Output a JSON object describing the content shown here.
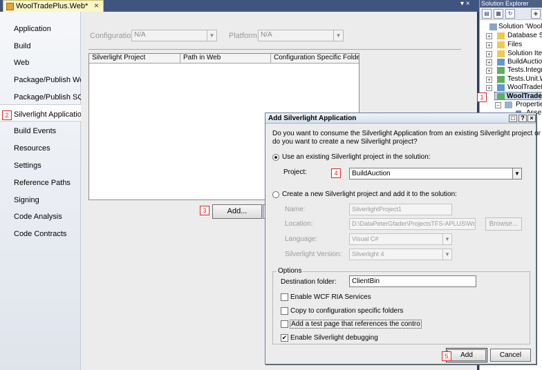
{
  "window": {
    "tab_title": "WoolTradePlus.Web*",
    "tab_close": "×",
    "tab_arrows": "▾ ×"
  },
  "nav": {
    "items": [
      {
        "label": "Application"
      },
      {
        "label": "Build"
      },
      {
        "label": "Web"
      },
      {
        "label": "Package/Publish Web"
      },
      {
        "label": "Package/Publish SQL"
      },
      {
        "label": "Silverlight Applications"
      },
      {
        "label": "Build Events"
      },
      {
        "label": "Resources"
      },
      {
        "label": "Settings"
      },
      {
        "label": "Reference Paths"
      },
      {
        "label": "Signing"
      },
      {
        "label": "Code Analysis"
      },
      {
        "label": "Code Contracts"
      }
    ],
    "selected_index": 5
  },
  "page": {
    "configuration_label": "Configuration:",
    "configuration_value": "N/A",
    "platform_label": "Platform:",
    "platform_value": "N/A",
    "table": {
      "columns": [
        "Silverlight Project",
        "Path in Web",
        "Configuration Specific Folders"
      ]
    },
    "add_button": "Add..."
  },
  "callouts": [
    "1",
    "2",
    "3",
    "4",
    "5"
  ],
  "solution_explorer": {
    "title": "Solution Explorer",
    "toolbar_icons": [
      "properties-icon",
      "show-all-files-icon",
      "refresh-icon",
      "view-class-diagram-icon"
    ],
    "items": [
      {
        "label": "Solution 'WoolTra",
        "expander": "−"
      },
      {
        "label": "Database Sc",
        "expander": "+"
      },
      {
        "label": "Files",
        "expander": "+"
      },
      {
        "label": "Solution Item",
        "expander": "+"
      },
      {
        "label": "BuildAuction",
        "expander": "+"
      },
      {
        "label": "Tests.Integr",
        "expander": "+"
      },
      {
        "label": "Tests.Unit.W",
        "expander": "+"
      },
      {
        "label": "WoolTradePl",
        "expander": "+"
      },
      {
        "label": "WoolTrade",
        "expander": "−"
      },
      {
        "label": "Propertie",
        "expander": "−"
      },
      {
        "label": "Asse",
        "expander": ""
      }
    ]
  },
  "dialog": {
    "title": "Add Silverlight Application",
    "title_buttons": [
      "□",
      "?",
      "×"
    ],
    "intro_line1": "Do you want to consume the Silverlight Application from an existing Silverlight project or",
    "intro_line2": "do you want to create a new Silverlight project?",
    "use_existing_label": "Use an existing Silverlight project in the solution:",
    "use_existing_selected": true,
    "project_label": "Project:",
    "project_value": "BuildAuction",
    "create_new_label": "Create a new Silverlight project and add it to the solution:",
    "name_label": "Name:",
    "name_value": "SilverlightProject1",
    "location_label": "Location:",
    "location_value": "D:\\DataPeterGfader\\ProjectsTFS-APLUS\\WoolTr",
    "browse_button": "Browse...",
    "language_label": "Language:",
    "language_value": "Visual C#",
    "version_label": "Silverlight Version:",
    "version_value": "Silverlight 4",
    "options_legend": "Options",
    "destination_label": "Destination folder:",
    "destination_value": "ClientBin",
    "checkboxes": [
      {
        "label": "Enable WCF RIA Services",
        "checked": false
      },
      {
        "label": "Copy to configuration specific folders",
        "checked": false
      },
      {
        "label": "Add a test page that references the contro",
        "checked": false
      },
      {
        "label": "Enable Silverlight debugging",
        "checked": true
      }
    ],
    "add_button": "Add",
    "cancel_button": "Cancel"
  },
  "colors": {
    "background_dark": "#2b3c59",
    "callout_red": "#d22222",
    "tab_yellow": "#fbf6c8"
  }
}
